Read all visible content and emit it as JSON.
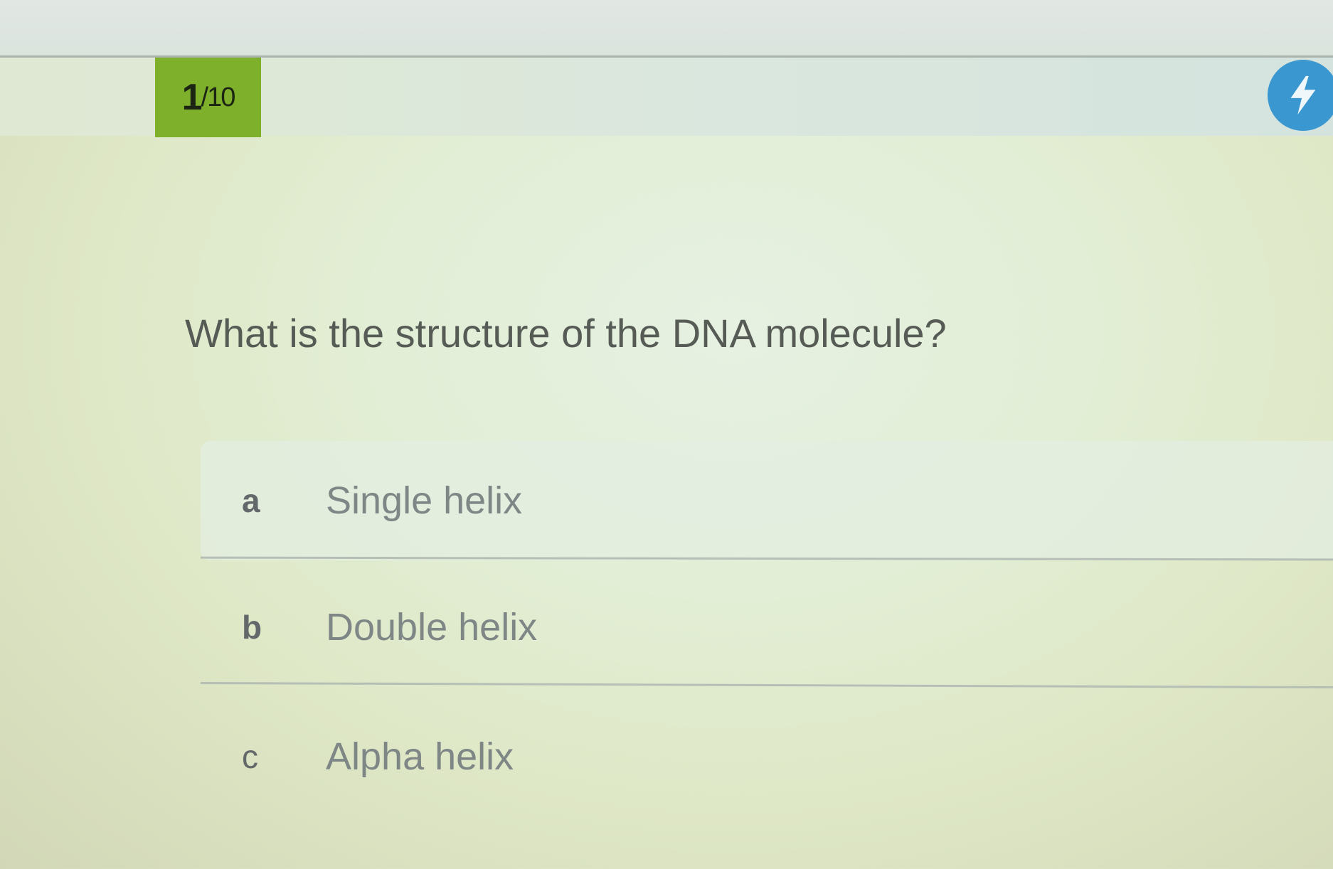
{
  "quiz": {
    "progress": {
      "current": "1",
      "total": "/10"
    },
    "question": "What is the structure of the DNA molecule?",
    "options": [
      {
        "letter": "a",
        "text": "Single helix"
      },
      {
        "letter": "b",
        "text": "Double helix"
      },
      {
        "letter": "c",
        "text": "Alpha helix"
      }
    ]
  },
  "icons": {
    "powerup": "lightning-bolt-icon"
  },
  "colors": {
    "counter_bg": "#7fb02c",
    "powerup_bg": "#3a97cf"
  }
}
